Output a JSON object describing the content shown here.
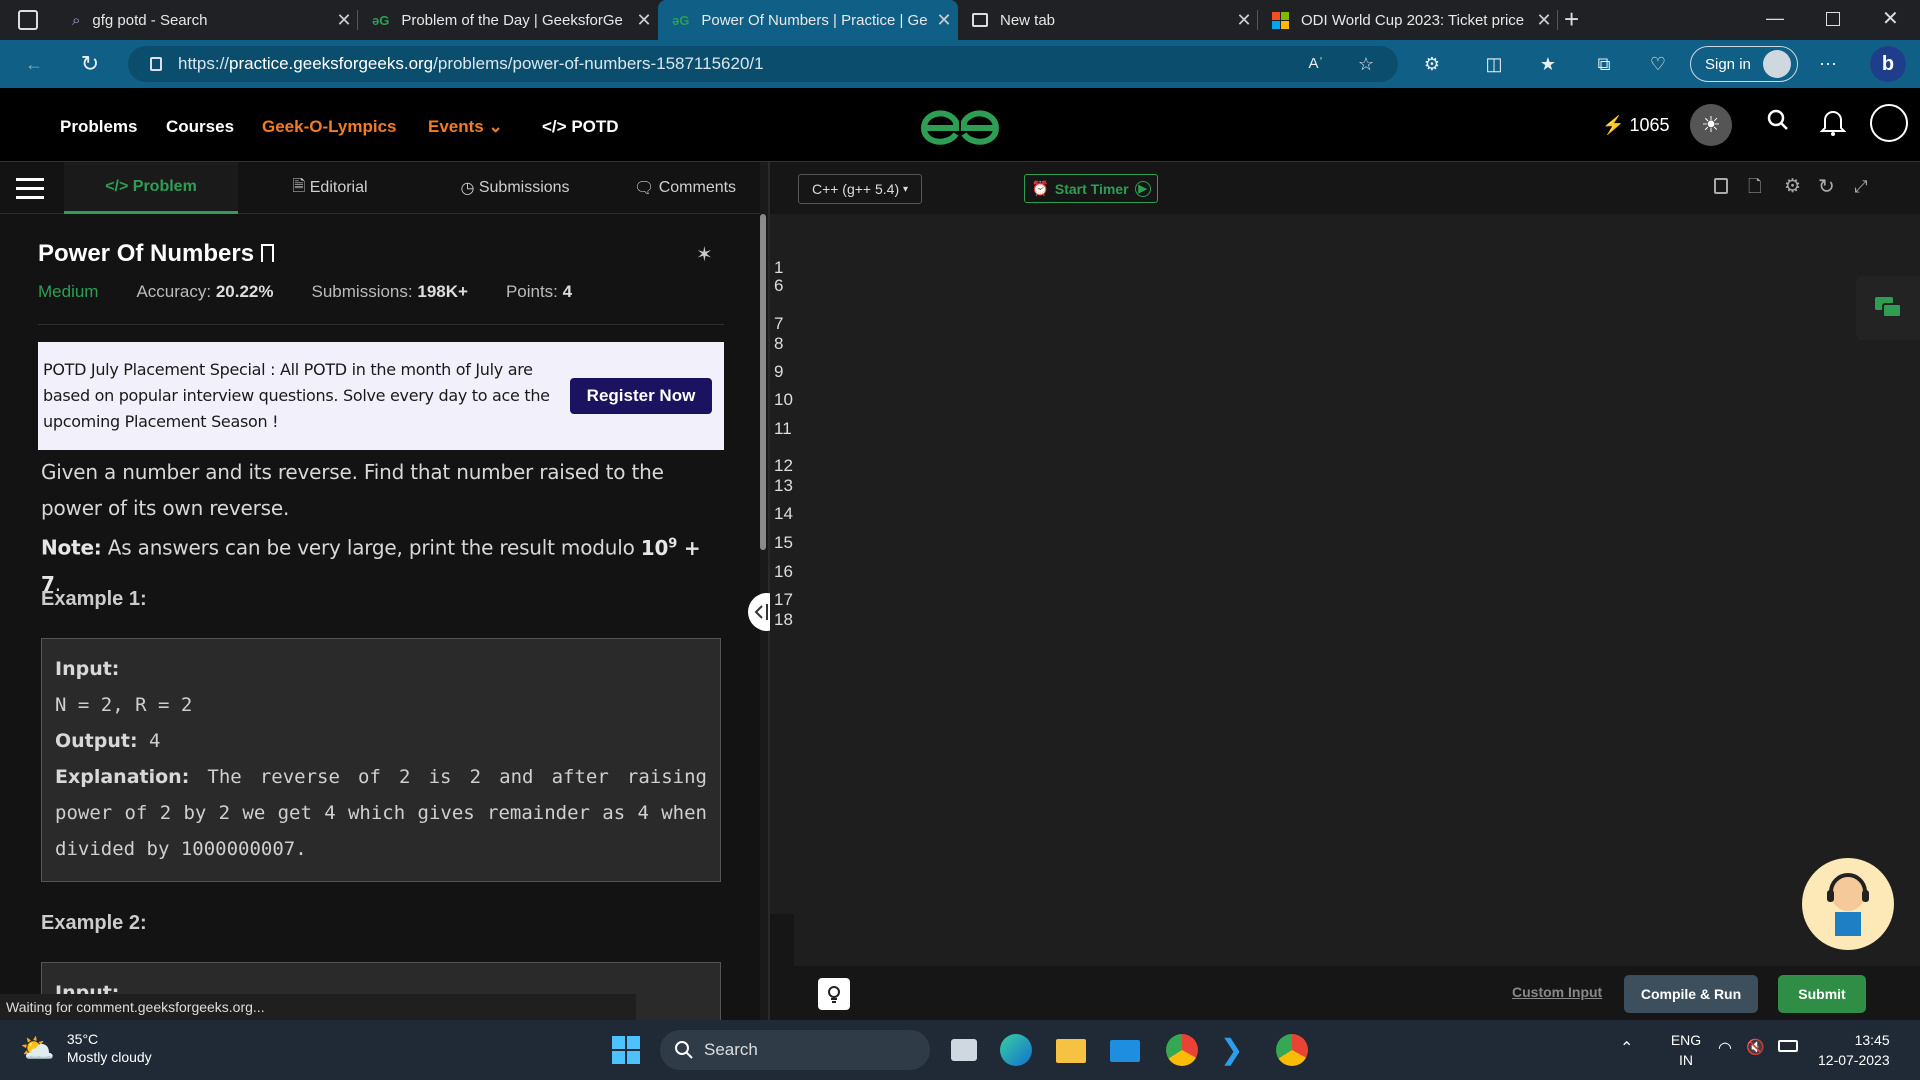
{
  "browser": {
    "tabs": [
      {
        "title": "gfg potd - Search",
        "icon": "search-icon",
        "active": false
      },
      {
        "title": "Problem of the Day | GeeksforGe",
        "icon": "gfg-logo-icon",
        "active": false
      },
      {
        "title": "Power Of Numbers | Practice | Ge",
        "icon": "gfg-logo-icon",
        "active": true
      },
      {
        "title": "New tab",
        "icon": "newtab-icon",
        "active": false
      },
      {
        "title": "ODI World Cup 2023: Ticket price",
        "icon": "ms-logo-icon",
        "active": false
      }
    ],
    "url_prefix": "https://",
    "url_domain": "practice.geeksforgeeks.org",
    "url_path": "/problems/power-of-numbers-1587115620/1",
    "signin_label": "Sign in"
  },
  "site": {
    "nav": {
      "problems": "Problems",
      "courses": "Courses",
      "geek_o_lympics": "Geek-O-Lympics",
      "events": "Events",
      "potd": "POTD"
    },
    "streak_count": "1065",
    "accent": "#2f9e55",
    "orange": "#f47c20"
  },
  "problem": {
    "tabs": {
      "problem": "Problem",
      "editorial": "Editorial",
      "submissions": "Submissions",
      "comments": "Comments"
    },
    "title": "Power Of Numbers",
    "difficulty": "Medium",
    "accuracy_label": "Accuracy:",
    "accuracy_value": "20.22%",
    "submissions_label": "Submissions:",
    "submissions_value": "198K+",
    "points_label": "Points:",
    "points_value": "4",
    "banner_text": "POTD July Placement Special : All POTD in the month of July are based on popular interview questions. Solve every day to ace the upcoming Placement Season !",
    "banner_button": "Register Now",
    "description": "Given a number and its reverse. Find that number raised to the power of its own reverse.",
    "note_label": "Note:",
    "note_text": "As answers can be very large, print the result modulo",
    "note_base": "10",
    "note_exp": "9",
    "note_tail": " + 7",
    "note_end": ".",
    "example1_heading": "Example 1:",
    "example1": {
      "input_label": "Input:",
      "input": "N = 2, R = 2",
      "output_label": "Output:",
      "output": "4",
      "explanation_label": "Explanation:",
      "explanation": "The reverse of 2 is 2 and after raising power of 2 by 2 we get 4 which gives remainder as 4 when divided by 1000000007."
    },
    "example2_heading": "Example 2:",
    "example2_input_label": "Input:"
  },
  "editor": {
    "language": "C++ (g++ 5.4)",
    "start_timer": "Start Timer",
    "line_numbers": [
      "1",
      "6",
      "7",
      "8",
      "9",
      "10",
      "11",
      "12",
      "13",
      "14",
      "15",
      "16",
      "17",
      "18"
    ],
    "custom_input": "Custom Input",
    "compile_run": "Compile & Run",
    "submit": "Submit"
  },
  "status_text": "Waiting for comment.geeksforgeeks.org...",
  "taskbar": {
    "temperature": "35°C",
    "weather": "Mostly cloudy",
    "search": "Search",
    "lang_top": "ENG",
    "lang_bottom": "IN",
    "time": "13:45",
    "date": "12-07-2023"
  }
}
